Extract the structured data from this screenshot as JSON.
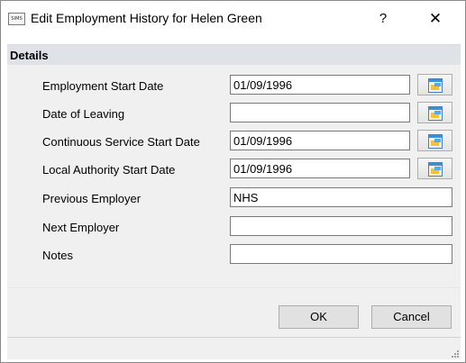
{
  "window": {
    "app_icon_text": "SIMS",
    "title": "Edit Employment History for Helen Green",
    "help_glyph": "?",
    "close_glyph": "✕"
  },
  "section": {
    "header": "Details"
  },
  "fields": {
    "employment_start": {
      "label": "Employment Start Date",
      "value": "01/09/1996"
    },
    "date_of_leaving": {
      "label": "Date of Leaving",
      "value": ""
    },
    "continuous_service": {
      "label": "Continuous Service Start Date",
      "value": "01/09/1996"
    },
    "la_start": {
      "label": "Local Authority Start Date",
      "value": "01/09/1996"
    },
    "previous_employer": {
      "label": "Previous Employer",
      "value": "NHS"
    },
    "next_employer": {
      "label": "Next Employer",
      "value": ""
    },
    "notes": {
      "label": "Notes",
      "value": ""
    }
  },
  "buttons": {
    "ok": "OK",
    "cancel": "Cancel"
  },
  "icons": {
    "calendar": "calendar-icon",
    "help": "help-icon",
    "close": "close-icon",
    "resize": "resize-grip-icon"
  }
}
